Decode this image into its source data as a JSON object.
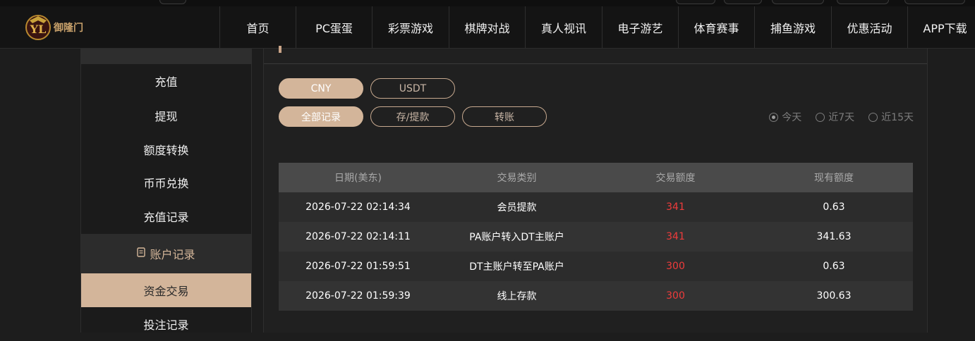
{
  "header": {
    "logo_text": "御隆门",
    "nav": [
      "首页",
      "PC蛋蛋",
      "彩票游戏",
      "棋牌对战",
      "真人视讯",
      "电子游艺",
      "体育赛事",
      "捕鱼游戏",
      "优惠活动",
      "APP下载"
    ]
  },
  "sidebar": {
    "items_top": [
      "充值",
      "提现",
      "额度转换",
      "币币兑换",
      "充值记录"
    ],
    "section_label": "账户记录",
    "items_bottom": [
      "资金交易",
      "投注记录"
    ],
    "active_item": "资金交易"
  },
  "main": {
    "currency_tabs": [
      "CNY",
      "USDT"
    ],
    "record_tabs": [
      "全部记录",
      "存/提款",
      "转账"
    ],
    "date_filters": [
      "今天",
      "近7天",
      "近15天"
    ],
    "selected_date_filter": "今天",
    "table": {
      "headers": [
        "日期(美东)",
        "交易类别",
        "交易额度",
        "现有额度"
      ],
      "rows": [
        [
          "2026-07-22 02:14:34",
          "会员提款",
          "341",
          "0.63"
        ],
        [
          "2026-07-22 02:14:11",
          "PA账户转入DT主账户",
          "341",
          "341.63"
        ],
        [
          "2026-07-22 01:59:51",
          "DT主账户转至PA账户",
          "300",
          "0.63"
        ],
        [
          "2026-07-22 01:59:39",
          "线上存款",
          "300",
          "300.63"
        ]
      ]
    }
  },
  "colors": {
    "accent": "#d3b59a",
    "amount": "#ef3b3b",
    "header_bg": "#141414",
    "table_head_bg": "#4a4a4a"
  }
}
